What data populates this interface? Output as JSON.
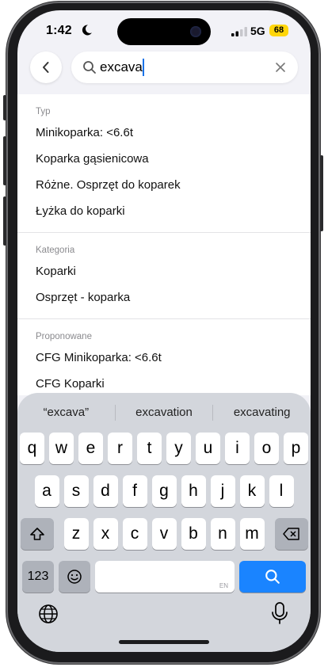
{
  "status": {
    "time": "1:42",
    "network": "5G",
    "battery": "68"
  },
  "search": {
    "query": "excava",
    "placeholder": ""
  },
  "sections": [
    {
      "label": "Typ",
      "items": [
        "Minikoparka: <6.6t",
        "Koparka gąsienicowa",
        "Różne. Osprzęt do koparek",
        "Łyżka do koparki"
      ]
    },
    {
      "label": "Kategoria",
      "items": [
        "Koparki",
        "Osprzęt - koparka"
      ]
    },
    {
      "label": "Proponowane",
      "items": [
        "CFG Minikoparka: <6.6t",
        "CFG Koparki"
      ]
    }
  ],
  "keyboard": {
    "suggestions": [
      "“excava”",
      "excavation",
      "excavating"
    ],
    "row1": [
      "q",
      "w",
      "e",
      "r",
      "t",
      "y",
      "u",
      "i",
      "o",
      "p"
    ],
    "row2": [
      "a",
      "s",
      "d",
      "f",
      "g",
      "h",
      "j",
      "k",
      "l"
    ],
    "row3": [
      "z",
      "x",
      "c",
      "v",
      "b",
      "n",
      "m"
    ],
    "numbers_label": "123",
    "space_lang": "EN"
  },
  "colors": {
    "accent": "#1a84ff",
    "battery": "#ffd60a"
  }
}
